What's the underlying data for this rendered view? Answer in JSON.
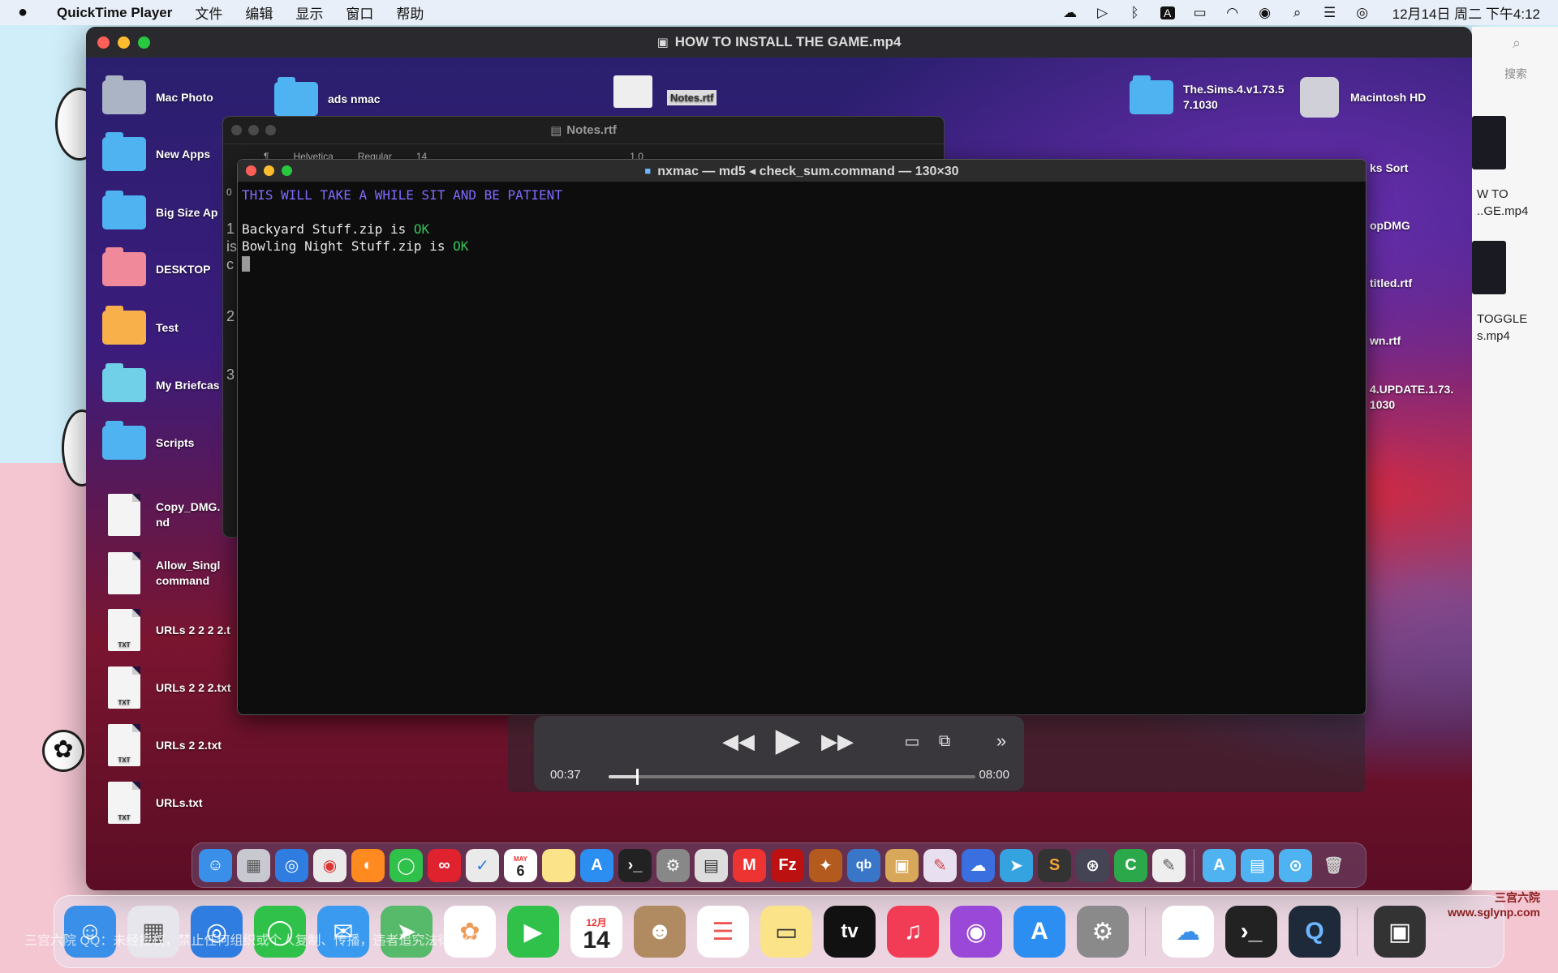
{
  "menubar": {
    "apple": "",
    "app_name": "QuickTime Player",
    "menus": [
      "文件",
      "编辑",
      "显示",
      "窗口",
      "帮助"
    ],
    "clock": "12月14日 周二 下午4:12",
    "status_icons": [
      "creative-cloud-icon",
      "play-circle-icon",
      "bluetooth-icon",
      "input-method-icon",
      "battery-icon",
      "wifi-icon",
      "user-icon",
      "search-icon",
      "control-center-icon",
      "siri-icon"
    ]
  },
  "qt_window": {
    "title": "HOW TO INSTALL THE GAME.mp4"
  },
  "inner_desktop": {
    "left_icons": [
      {
        "label": "Mac Photo",
        "kind": "folder-gray"
      },
      {
        "label": "New Apps",
        "kind": "folder"
      },
      {
        "label": "Big Size Ap",
        "kind": "folder"
      },
      {
        "label": "DESKTOP",
        "kind": "folder-pink"
      },
      {
        "label": "Test",
        "kind": "folder-orange"
      },
      {
        "label": "My Briefcas",
        "kind": "folder-teal"
      },
      {
        "label": "Scripts",
        "kind": "folder"
      },
      {
        "label": "Copy_DMG.\nnd",
        "kind": "doc"
      },
      {
        "label": "Allow_Singl\ncommand",
        "kind": "doc"
      },
      {
        "label": "URLs 2 2 2 2.t",
        "kind": "txt"
      },
      {
        "label": "URLs 2 2 2.txt",
        "kind": "txt"
      },
      {
        "label": "URLs 2 2.txt",
        "kind": "txt"
      },
      {
        "label": "URLs.txt",
        "kind": "txt"
      }
    ],
    "top_labels": {
      "ads": "ads nmac",
      "notes_file": "Notes.rtf",
      "sims": "The.Sims.4.v1.73.5\n7.1030",
      "hd": "Macintosh HD"
    },
    "right_labels": [
      "ks Sort",
      "opDMG",
      "titled.rtf",
      "wn.rtf",
      "4.UPDATE.1.73.\n1030"
    ],
    "txt_badge": "TXT"
  },
  "notes_window": {
    "title": "Notes.rtf",
    "toolbar": [
      "¶",
      "Helvetica",
      "Regular",
      "14",
      "1.0"
    ],
    "margin_chars": [
      "0",
      "1",
      "is",
      "c",
      "2",
      "3"
    ]
  },
  "terminal": {
    "title": "nxmac — md5 ◂ check_sum.command — 130×30",
    "header_line": "THIS WILL TAKE A WHILE SIT AND BE PATIENT",
    "lines": [
      {
        "text": "Backyard Stuff.zip is ",
        "status": "OK"
      },
      {
        "text": "Bowling Night Stuff.zip is ",
        "status": "OK"
      }
    ]
  },
  "player": {
    "current_time": "00:37",
    "total_time": "08:00",
    "progress_fraction": 0.077,
    "rewind_icon": "rewind-icon",
    "play_icon": "play-icon",
    "ff_icon": "fast-forward-icon"
  },
  "inner_dock": {
    "calendar_day": "6",
    "calendar_month": "MAY",
    "apps": [
      "finder",
      "launchpad",
      "safari",
      "chrome",
      "firefox",
      "messages",
      "creative-cloud",
      "mail-app",
      "calendar",
      "notes",
      "app-store",
      "terminal",
      "system-prefs",
      "calculator",
      "gmail",
      "filezilla",
      "rocket",
      "qbittorrent",
      "preview",
      "pixelmator",
      "cloud",
      "telegram",
      "sublime",
      "network",
      "coda",
      "textedit"
    ]
  },
  "host_side": {
    "search_label": "搜索",
    "labels": [
      "W TO\n..GE.mp4",
      "TOGGLE\ns.mp4"
    ]
  },
  "host_dock": {
    "calendar_month": "12月",
    "calendar_day": "14",
    "tv_label": "tv",
    "watermark": "三宫六院 QQ：未经授权，禁止任何组织或个人复制、传播，违者追究法律责任",
    "corner_logo": "三宫六院\nwww.sglynp.com"
  }
}
